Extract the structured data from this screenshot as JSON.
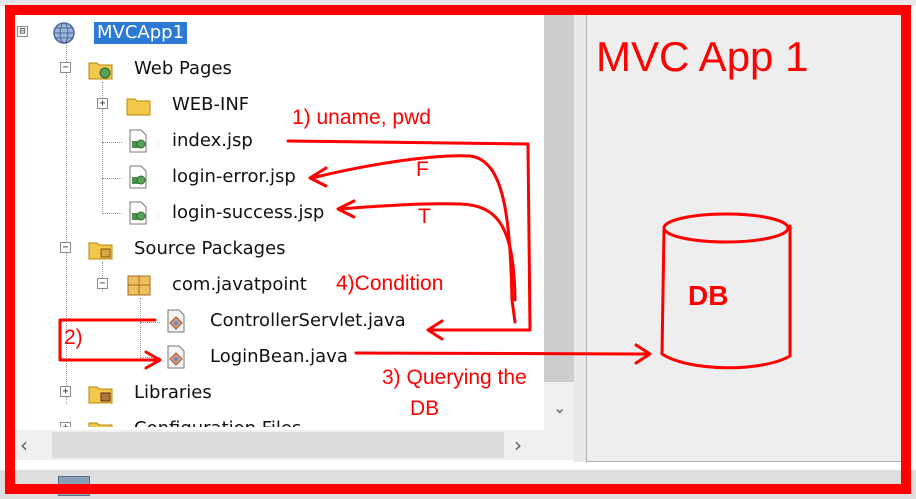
{
  "project_tree": {
    "root": {
      "label": "MVCApp1",
      "icon": "globe-project-icon",
      "expander": "⊟"
    },
    "web_pages": {
      "label": "Web Pages",
      "icon": "web-folder-icon"
    },
    "web_inf": {
      "label": "WEB-INF",
      "icon": "folder-icon"
    },
    "index_jsp": {
      "label": "index.jsp",
      "icon": "jsp-file-icon"
    },
    "login_error_jsp": {
      "label": "login-error.jsp",
      "icon": "jsp-file-icon"
    },
    "login_success_jsp": {
      "label": "login-success.jsp",
      "icon": "jsp-file-icon"
    },
    "source_packages": {
      "label": "Source Packages",
      "icon": "source-folder-icon"
    },
    "package": {
      "label": "com.javatpoint",
      "icon": "package-icon"
    },
    "controller_servlet": {
      "label": "ControllerServlet.java",
      "icon": "java-class-icon"
    },
    "login_bean": {
      "label": "LoginBean.java",
      "icon": "java-class-icon"
    },
    "libraries": {
      "label": "Libraries",
      "icon": "library-folder-icon"
    },
    "config_files": {
      "label": "Configuration Files",
      "icon": "config-folder-icon"
    }
  },
  "annotations": {
    "title": "MVC App 1",
    "step1": "1) uname, pwd",
    "false_branch": "F",
    "true_branch": "T",
    "step4": "4)Condition",
    "step2": "2)",
    "step3_line1": "3) Querying the",
    "step3_line2": "DB",
    "db": "DB"
  },
  "colors": {
    "annotation": "#ff0000",
    "selection": "#2d7ad6"
  }
}
